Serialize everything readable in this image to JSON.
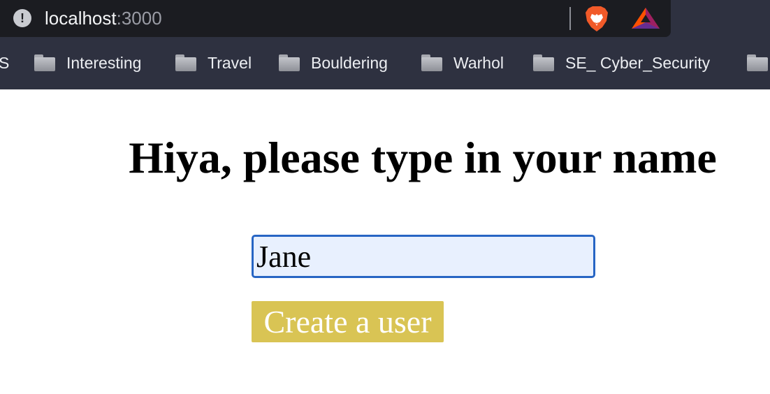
{
  "browser": {
    "url_host": "localhost",
    "url_port": ":3000",
    "info_symbol": "!",
    "bookmarks": [
      {
        "label": "S",
        "icon": "folder-icon",
        "has_icon": false
      },
      {
        "label": "Interesting",
        "icon": "folder-icon",
        "has_icon": true
      },
      {
        "label": "Travel",
        "icon": "folder-icon",
        "has_icon": true
      },
      {
        "label": "Bouldering",
        "icon": "folder-icon",
        "has_icon": true
      },
      {
        "label": "Warhol",
        "icon": "folder-icon",
        "has_icon": true
      },
      {
        "label": "SE_ Cyber_Security",
        "icon": "folder-icon",
        "has_icon": true
      }
    ],
    "extensions": [
      "brave-lion-icon",
      "bat-rewards-icon"
    ],
    "colors": {
      "chrome_bg": "#2e3140",
      "address_bg": "#1b1c21"
    }
  },
  "page": {
    "title": "Hiya, please type in your name",
    "name_input_value": "Jane",
    "create_button_label": "Create a user",
    "colors": {
      "button_bg": "#d9c454",
      "input_border": "#2765c4",
      "input_bg": "#e8f0fe"
    }
  }
}
